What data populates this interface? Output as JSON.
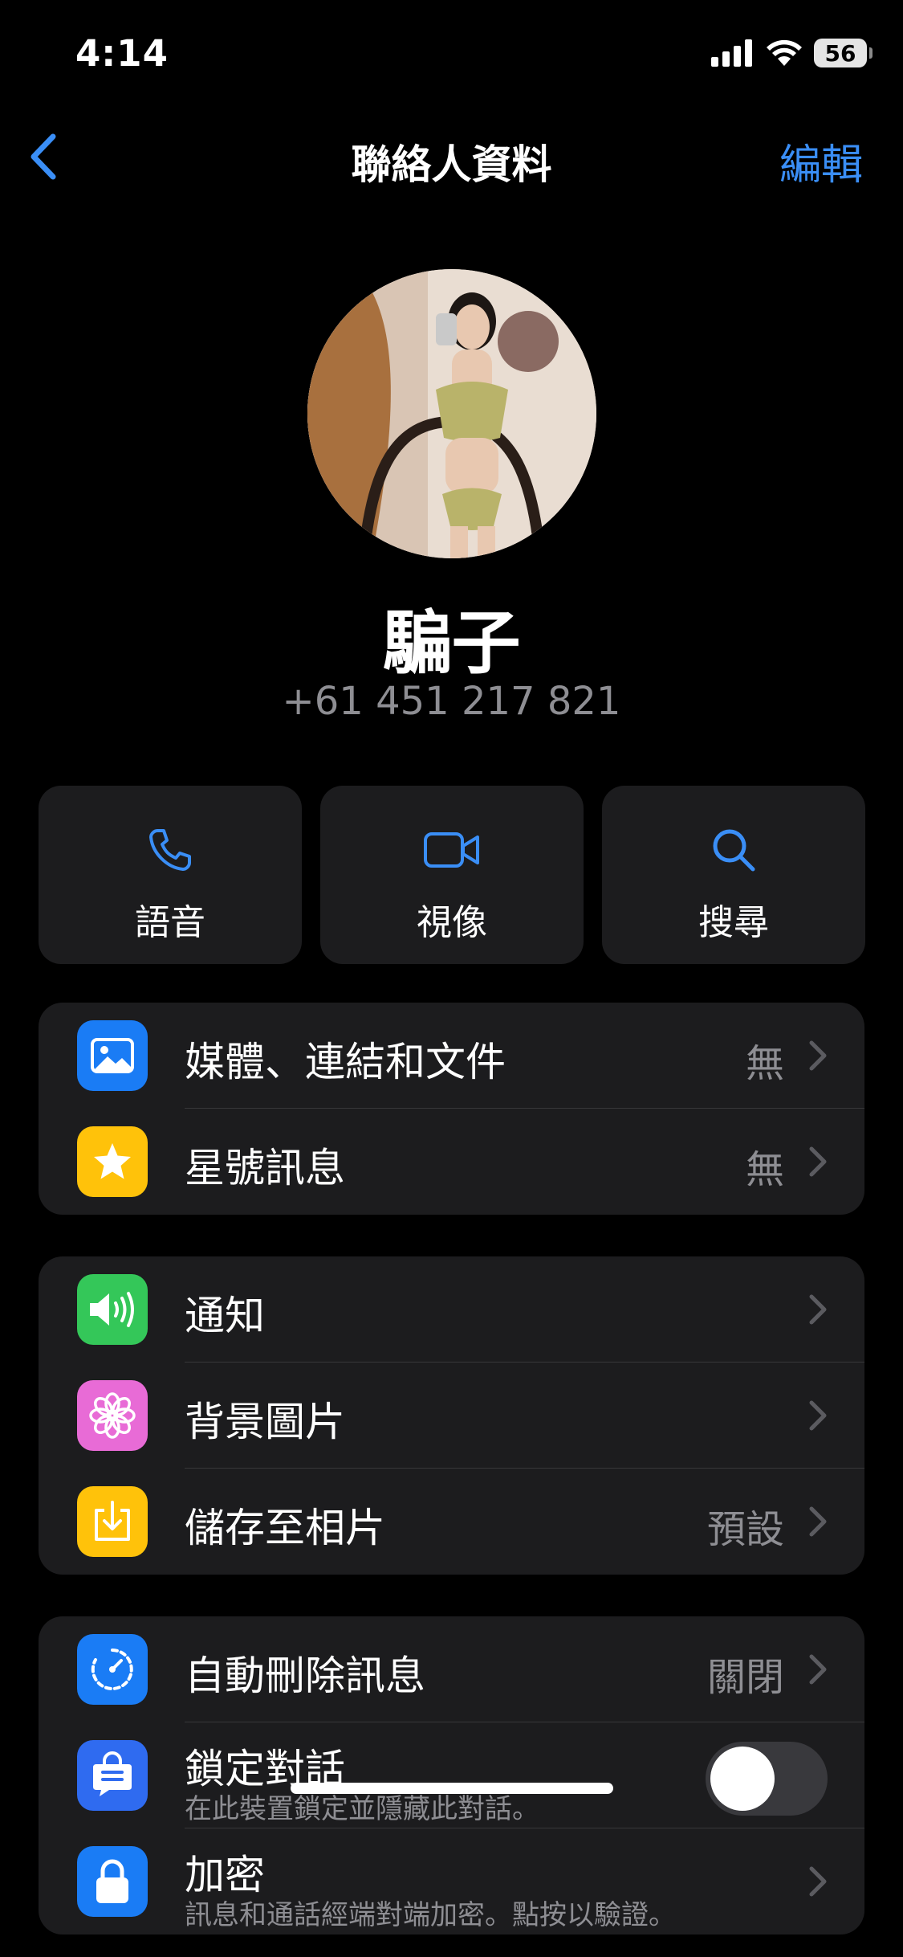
{
  "status_bar": {
    "time": "4:14",
    "battery": "56"
  },
  "nav": {
    "back_icon": "chevron-left-icon",
    "title": "聯絡人資料",
    "edit_label": "編輯"
  },
  "contact": {
    "name": "騙子",
    "phone": "+61 451 217 821"
  },
  "actions": [
    {
      "label": "語音",
      "icon": "phone-icon"
    },
    {
      "label": "視像",
      "icon": "video-icon"
    },
    {
      "label": "搜尋",
      "icon": "search-icon"
    }
  ],
  "group1": [
    {
      "label": "媒體、連結和文件",
      "value": "無",
      "icon": "image-icon",
      "color": "#1a7cf5"
    },
    {
      "label": "星號訊息",
      "value": "無",
      "icon": "star-icon",
      "color": "#ffc20a"
    }
  ],
  "group2": [
    {
      "label": "通知",
      "value": "",
      "icon": "speaker-icon",
      "color": "#34c759"
    },
    {
      "label": "背景圖片",
      "value": "",
      "icon": "flower-icon",
      "color": "#e86bd6"
    },
    {
      "label": "儲存至相片",
      "value": "預設",
      "icon": "download-icon",
      "color": "#ffc20a"
    }
  ],
  "group3": [
    {
      "label": "自動刪除訊息",
      "value": "關閉",
      "icon": "timer-icon",
      "color": "#1a7cf5"
    },
    {
      "label": "鎖定對話",
      "sub": "在此裝置鎖定並隱藏此對話。",
      "toggle": false,
      "icon": "chat-lock-icon",
      "color": "#2f6bf0"
    },
    {
      "label": "加密",
      "sub": "訊息和通話經端對端加密。點按以驗證。",
      "icon": "lock-icon",
      "color": "#1a7cf5"
    }
  ],
  "colors": {
    "accent": "#3a8ef6",
    "background": "#000000",
    "card": "#1c1c1e",
    "secondary_text": "#8e8e93"
  }
}
